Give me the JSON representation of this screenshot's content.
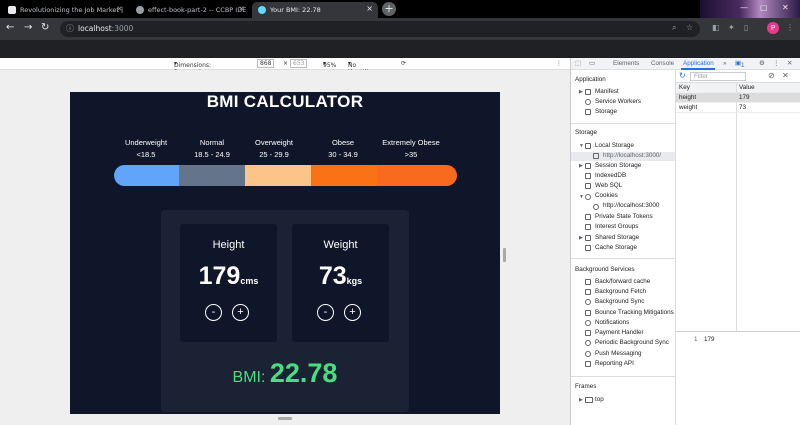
{
  "tabs": [
    {
      "title": "Revolutionizing the Job Market |",
      "active": false
    },
    {
      "title": "effect-book-part-2 -- CCBP IDE",
      "active": false
    },
    {
      "title": "Your BMI: 22.78",
      "active": true
    }
  ],
  "address": {
    "host": "localhost",
    "port": ":3000"
  },
  "profile_initial": "P",
  "device_toolbar": {
    "dimensions_label": "Dimensions: Responsive",
    "width": "868",
    "height": "653",
    "zoom": "95%",
    "throttling": "No throttling"
  },
  "app": {
    "title": "BMI CALCULATOR",
    "categories": [
      {
        "name": "Underweight",
        "range": "<18.5",
        "color": "#60a5fa"
      },
      {
        "name": "Normal",
        "range": "18.5 - 24.9",
        "color": "#64748b"
      },
      {
        "name": "Overweight",
        "range": "25 - 29.9",
        "color": "#fdc48a"
      },
      {
        "name": "Obese",
        "range": "30 - 34.9",
        "color": "#f97316"
      },
      {
        "name": "Extremely Obese",
        "range": ">35",
        "color": "#f96a1e"
      }
    ],
    "height": {
      "label": "Height",
      "value": "179",
      "unit": "cms",
      "minus": "-",
      "plus": "+"
    },
    "weight": {
      "label": "Weight",
      "value": "73",
      "unit": "kgs",
      "minus": "-",
      "plus": "+"
    },
    "bmi": {
      "label": "BMI:",
      "value": "22.78"
    }
  },
  "devtools": {
    "tabs": [
      "Elements",
      "Console",
      "Application"
    ],
    "issues_count": "1",
    "filter_placeholder": "Filter",
    "sections": {
      "application": {
        "title": "Application",
        "items": [
          "Manifest",
          "Service Workers",
          "Storage"
        ]
      },
      "storage": {
        "title": "Storage",
        "local_storage": "Local Storage",
        "local_storage_origin": "http://localhost:3000/",
        "items": [
          "Session Storage",
          "IndexedDB",
          "Web SQL"
        ],
        "cookies": "Cookies",
        "cookies_origin": "http://localhost:3000",
        "more": [
          "Private State Tokens",
          "Interest Groups",
          "Shared Storage",
          "Cache Storage"
        ]
      },
      "background": {
        "title": "Background Services",
        "items": [
          "Back/forward cache",
          "Background Fetch",
          "Background Sync",
          "Bounce Tracking Mitigations",
          "Notifications",
          "Payment Handler",
          "Periodic Background Sync",
          "Push Messaging",
          "Reporting API"
        ]
      },
      "frames": {
        "title": "Frames",
        "items": [
          "top"
        ]
      }
    },
    "table": {
      "headers": [
        "Key",
        "Value"
      ],
      "rows": [
        {
          "key": "height",
          "value": "179"
        },
        {
          "key": "weight",
          "value": "73"
        }
      ]
    },
    "preview": {
      "line": "1",
      "value": "179"
    }
  }
}
